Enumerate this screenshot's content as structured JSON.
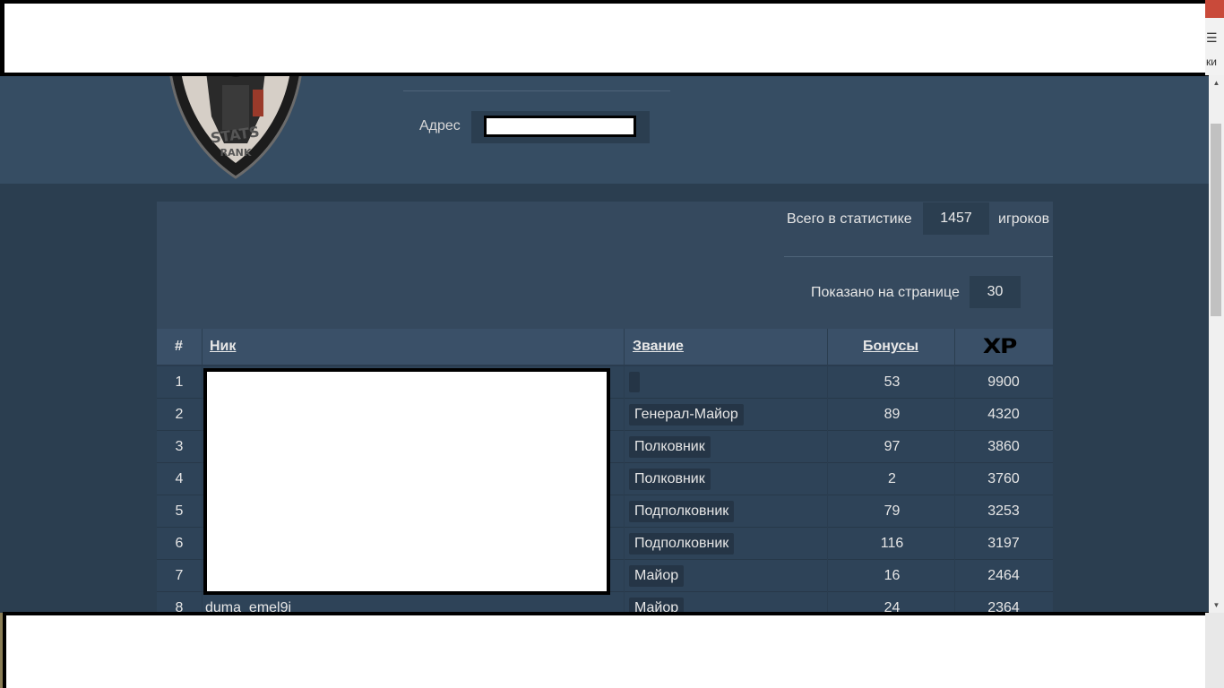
{
  "header": {
    "address_label": "Адрес",
    "logo_text": "STATS RANK"
  },
  "stats": {
    "total_label": "Всего в статистике",
    "total_value": "1457",
    "players_label": "игроков",
    "shown_label": "Показано на странице",
    "shown_value": "30"
  },
  "table": {
    "columns": {
      "num": "#",
      "nick": "Ник",
      "rank": "Звание",
      "bonus": "Бонусы",
      "xp": "XP"
    },
    "rows": [
      {
        "num": "1",
        "nick": "",
        "rank": "",
        "bonus": "53",
        "xp": "9900"
      },
      {
        "num": "2",
        "nick": "",
        "rank": "Генерал-Майор",
        "bonus": "89",
        "xp": "4320"
      },
      {
        "num": "3",
        "nick": "",
        "rank": "Полковник",
        "bonus": "97",
        "xp": "3860"
      },
      {
        "num": "4",
        "nick": "",
        "rank": "Полковник",
        "bonus": "2",
        "xp": "3760"
      },
      {
        "num": "5",
        "nick": "",
        "rank": "Подполковник",
        "bonus": "79",
        "xp": "3253"
      },
      {
        "num": "6",
        "nick": "",
        "rank": "Подполковник",
        "bonus": "116",
        "xp": "3197"
      },
      {
        "num": "7",
        "nick": "",
        "rank": "Майор",
        "bonus": "16",
        "xp": "2464"
      },
      {
        "num": "8",
        "nick": "duma_emel9i",
        "rank": "Майор",
        "bonus": "24",
        "xp": "2364"
      }
    ]
  },
  "browser": {
    "edge_text": "ки",
    "menu_icon": "hamburger-menu-icon"
  },
  "colors": {
    "page_bg": "#2b3e50",
    "header_bg": "#364d63",
    "panel_bg": "#35495e",
    "row_bg": "#2e4358"
  }
}
